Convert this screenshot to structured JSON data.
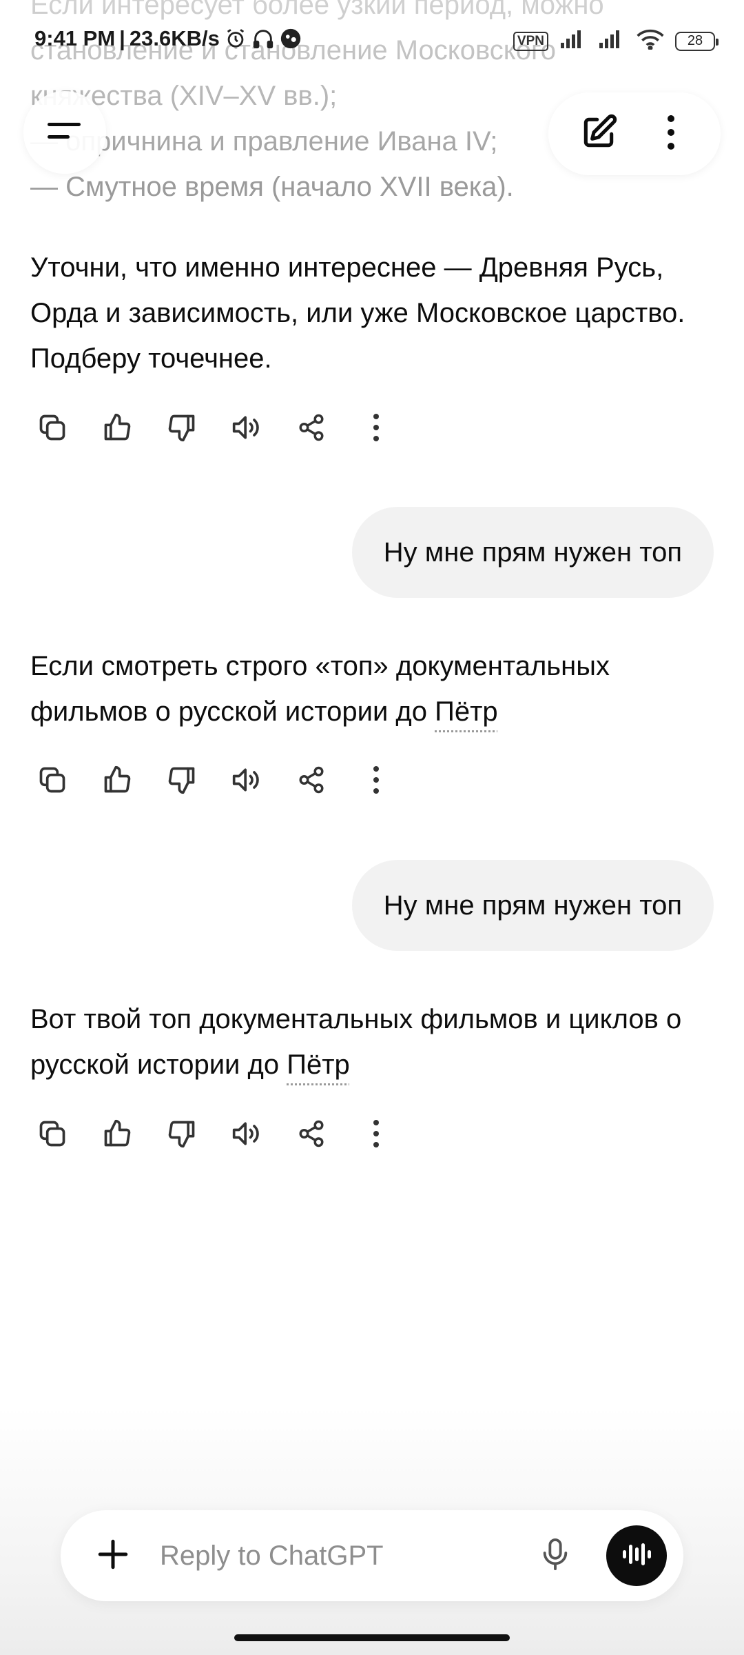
{
  "status_bar": {
    "time": "9:41 PM",
    "speed": "23.6KB/s",
    "vpn": "VPN",
    "battery": "28"
  },
  "faded_message": {
    "lines": [
      "Если интересует более узкий период, можно",
      "  становление и становление Московского",
      "княжества (XIV–XV вв.);",
      "— опричнина и правление Ивана IV;",
      "— Смутное время (начало XVII века)."
    ]
  },
  "messages": {
    "assistant_1": "Уточни, что именно интереснее — Древняя Русь, Орда и зависимость, или уже Московское царство. Подберу точечнее.",
    "user_1": "Ну мне прям нужен топ",
    "assistant_2_main": "Если смотреть строго «топ» документальных фильмов о русской истории до ",
    "assistant_2_link": "Пётр",
    "user_2": "Ну мне прям нужен топ",
    "assistant_3_main": "Вот твой топ документальных фильмов и циклов о русской истории до ",
    "assistant_3_link": "Пётр"
  },
  "actions": {
    "icons": [
      "copy-icon",
      "thumbs-up-icon",
      "thumbs-down-icon",
      "read-aloud-icon",
      "share-icon",
      "more-icon"
    ]
  },
  "composer": {
    "placeholder": "Reply to ChatGPT"
  }
}
